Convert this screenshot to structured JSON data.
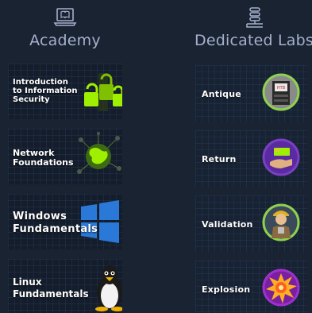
{
  "columns": {
    "academy": {
      "title": "Academy",
      "icon": "laptop-book-icon"
    },
    "labs": {
      "title": "Dedicated Labs",
      "icon": "server-stack-icon"
    }
  },
  "academy_modules": [
    {
      "label": "Introduction\nto Information\nSecurity",
      "icon": "padlocks-icon",
      "accent": "#9fef00"
    },
    {
      "label": "Network\nFoundations",
      "icon": "globe-network-icon",
      "accent": "#9fef00"
    },
    {
      "label": "Windows\nFundamentals",
      "icon": "windows-logo-icon",
      "accent": "#2a79d8"
    },
    {
      "label": "Linux\nFundamentals",
      "icon": "linux-penguin-icon",
      "accent": "#ffffff"
    }
  ],
  "labs": [
    {
      "label": "Antique",
      "icon": "printer-avatar-icon",
      "ring": "#8fd14f"
    },
    {
      "label": "Return",
      "icon": "hand-card-avatar-icon",
      "ring": "#7a3fc2"
    },
    {
      "label": "Validation",
      "icon": "worker-avatar-icon",
      "ring": "#8fd14f"
    },
    {
      "label": "Explosion",
      "icon": "explosion-avatar-icon",
      "ring": "#a02fd0"
    }
  ],
  "colors": {
    "background": "#1a2332",
    "header_text": "#a4b1cd",
    "card_bg": "#141d2b",
    "htb_green": "#9fef00"
  }
}
